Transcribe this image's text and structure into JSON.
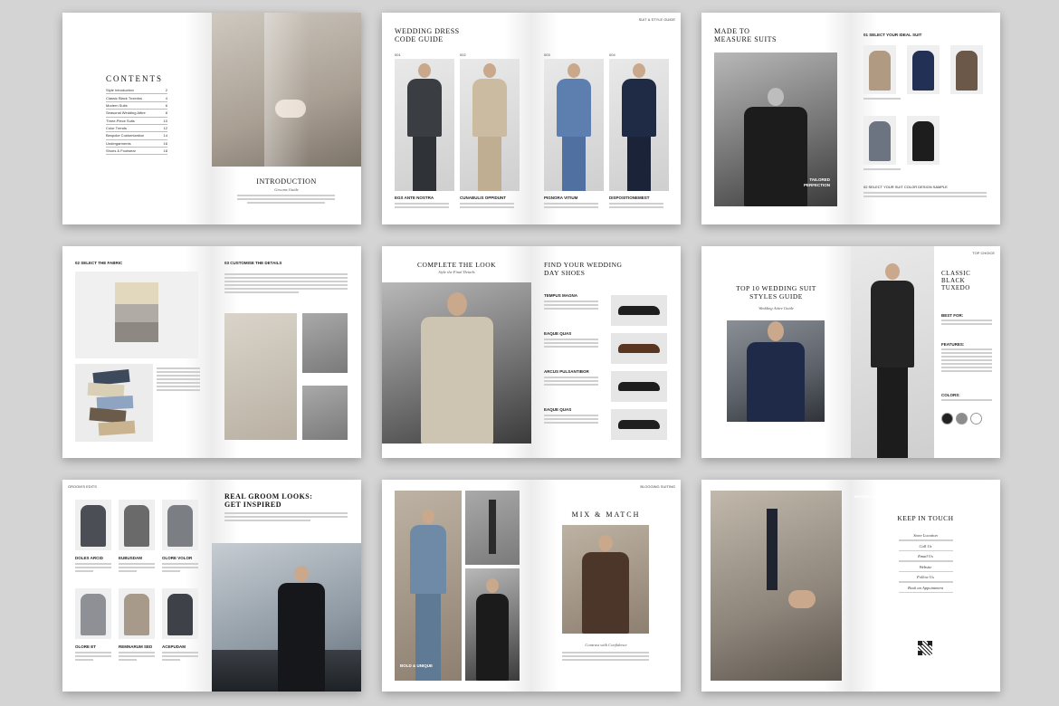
{
  "spread1": {
    "contents_title": "CONTENTS",
    "toc": [
      {
        "label": "Style Introduction",
        "page": "2"
      },
      {
        "label": "Classic Black Tuxedos",
        "page": "4"
      },
      {
        "label": "Modern Suits",
        "page": "6"
      },
      {
        "label": "Seasonal Wedding Attire",
        "page": "8"
      },
      {
        "label": "Three-Piece Suits",
        "page": "10"
      },
      {
        "label": "Color Trends",
        "page": "12"
      },
      {
        "label": "Bespoke Customization",
        "page": "14"
      },
      {
        "label": "Undergarments",
        "page": "16"
      },
      {
        "label": "Shoes & Footwear",
        "page": "18"
      }
    ],
    "intro_title": "INTRODUCTION",
    "intro_sub": "Grooms Guide"
  },
  "spread2": {
    "title_line1": "WEDDING DRESS",
    "title_line2": "CODE GUIDE",
    "header": "SUIT & STYLE GUIDE",
    "looks": [
      {
        "num": "001",
        "caption": "EGS ANTE NOSTRA"
      },
      {
        "num": "002",
        "caption": "CUNABULIS OPPIDUNT"
      },
      {
        "num": "003",
        "caption": "PIGNORA VITIUM"
      },
      {
        "num": "004",
        "caption": "DISPOSITIONEMEST"
      }
    ]
  },
  "spread3": {
    "title_line1": "MADE TO",
    "title_line2": "MEASURE SUITS",
    "overlay_line1": "TAILORED",
    "overlay_line2": "PERFECTION",
    "select_heading": "01 SELECT YOUR IDEAL SUIT",
    "colour_heading": "02 SELECT YOUR SUIT COLOR DESIGN SAMPLE"
  },
  "spread4": {
    "fabric_heading": "02 SELECT THE FABRIC",
    "customise_heading": "03 CUSTOMISE THE DETAILS"
  },
  "spread5": {
    "complete_title": "COMPLETE THE LOOK",
    "complete_sub": "Style the Final Details",
    "shoes_line1": "FIND YOUR WEDDING",
    "shoes_line2": "DAY SHOES",
    "shoes": [
      {
        "name": "TEMPUS MAGNA"
      },
      {
        "name": "EAQUE QUAS"
      },
      {
        "name": "ARCUS PULSANTIBOR"
      },
      {
        "name": "EAQUE QUAS"
      }
    ]
  },
  "spread6": {
    "top_line1": "TOP 10 WEDDING SUIT",
    "top_line2": "STYLES GUIDE",
    "top_sub": "Wedding Attire Guide",
    "header": "TOP CHOICE",
    "tux_line1": "CLASSIC",
    "tux_line2": "BLACK",
    "tux_line3": "TUXEDO",
    "best_for": "BEST FOR:",
    "features": "FEATURES:",
    "colors": "COLORS:",
    "colors_hex": [
      "#222222",
      "#8c8c8c",
      "#ffffff"
    ]
  },
  "spread7": {
    "header": "GROOM'S EDITS",
    "title_line1": "REAL GROOM LOOKS:",
    "title_line2": "GET INSPIRED",
    "suits": [
      {
        "name": "DOLES ARCID"
      },
      {
        "name": "EUBUSDAM"
      },
      {
        "name": "OLORE VOLOR"
      },
      {
        "name": "OLORE ET"
      },
      {
        "name": "REMNARUM SED"
      },
      {
        "name": "ACEPUDAM"
      }
    ]
  },
  "spread8": {
    "header": "BLOGGING SUITING",
    "label": "BOLD & UNIQUE",
    "title": "MIX & MATCH",
    "sub": "Contrast with Confidence"
  },
  "spread9": {
    "overlay": "MODERN CLASSICS",
    "title": "KEEP IN TOUCH",
    "sections": [
      "Store Location",
      "Call Us",
      "Email Us",
      "Website",
      "Follow Us",
      "Book an Appointment"
    ]
  }
}
